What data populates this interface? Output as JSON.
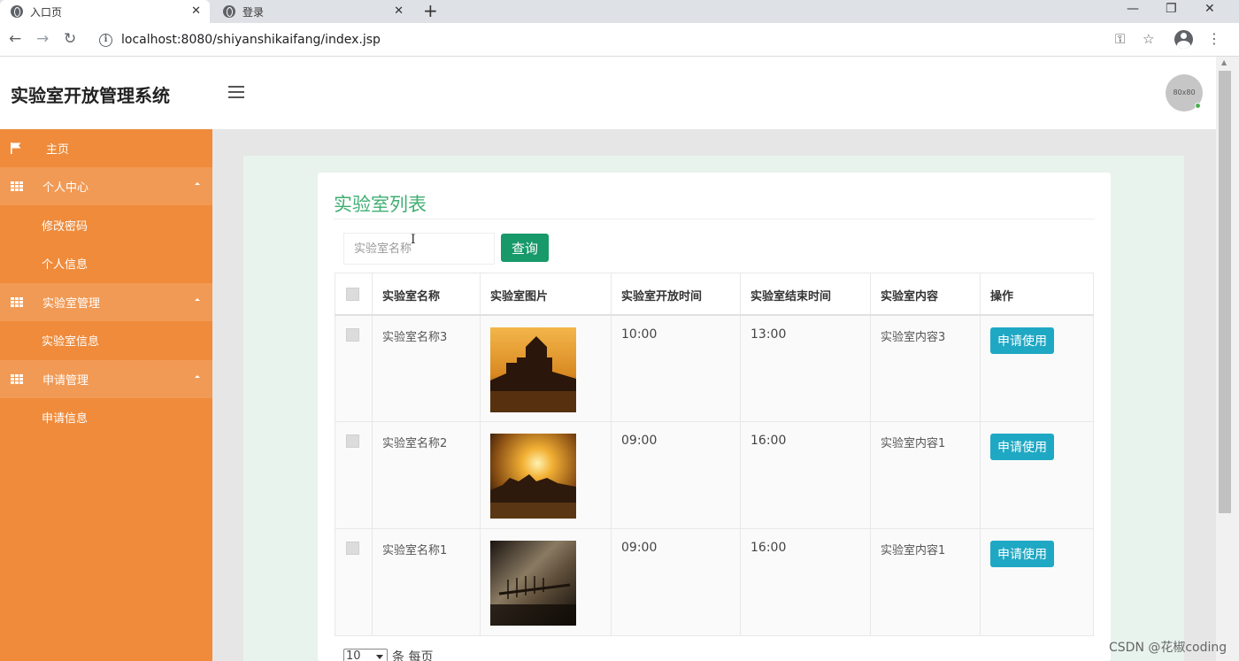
{
  "browser": {
    "tabs": [
      {
        "title": "入口页",
        "close": "✕"
      },
      {
        "title": "登录",
        "close": "✕"
      }
    ],
    "new_tab": "+",
    "window_controls": {
      "minimize": "—",
      "restore": "❐",
      "close": "✕"
    },
    "nav": {
      "back": "←",
      "forward": "→",
      "reload": "↻"
    },
    "url": "localhost:8080/shiyanshikaifang/index.jsp",
    "icons": {
      "info": "i",
      "key": "⚿",
      "star": "☆",
      "menu": "⋮"
    }
  },
  "header": {
    "title": "实验室开放管理系统",
    "avatar_text": "80x80"
  },
  "sidebar": {
    "items": [
      {
        "label": "主页",
        "type": "top",
        "icon": "flag-icon"
      },
      {
        "label": "个人中心",
        "type": "group",
        "icon": "grid-icon"
      },
      {
        "label": "修改密码",
        "type": "sub"
      },
      {
        "label": "个人信息",
        "type": "sub"
      },
      {
        "label": "实验室管理",
        "type": "group",
        "icon": "grid-icon"
      },
      {
        "label": "实验室信息",
        "type": "sub"
      },
      {
        "label": "申请管理",
        "type": "group",
        "icon": "grid-icon"
      },
      {
        "label": "申请信息",
        "type": "sub"
      }
    ]
  },
  "main": {
    "title": "实验室列表",
    "search": {
      "placeholder": "实验室名称",
      "button": "查询",
      "cursor": "I"
    },
    "table": {
      "columns": [
        "实验室名称",
        "实验室图片",
        "实验室开放时间",
        "实验室结束时间",
        "实验室内容",
        "操作"
      ],
      "rows": [
        {
          "name": "实验室名称3",
          "open": "10:00",
          "close": "13:00",
          "content": "实验室内容3",
          "action": "申请使用"
        },
        {
          "name": "实验室名称2",
          "open": "09:00",
          "close": "16:00",
          "content": "实验室内容1",
          "action": "申请使用"
        },
        {
          "name": "实验室名称1",
          "open": "09:00",
          "close": "16:00",
          "content": "实验室内容1",
          "action": "申请使用"
        }
      ]
    },
    "pager": {
      "page_size": "10",
      "suffix": "条 每页"
    }
  },
  "watermark": "CSDN @花椒coding",
  "colors": {
    "sidebar": "#ef8b3b",
    "sidebar_group": "#f19a55",
    "title_green": "#3fae72",
    "search_button": "#17996a",
    "apply_button": "#1fa8c4"
  }
}
